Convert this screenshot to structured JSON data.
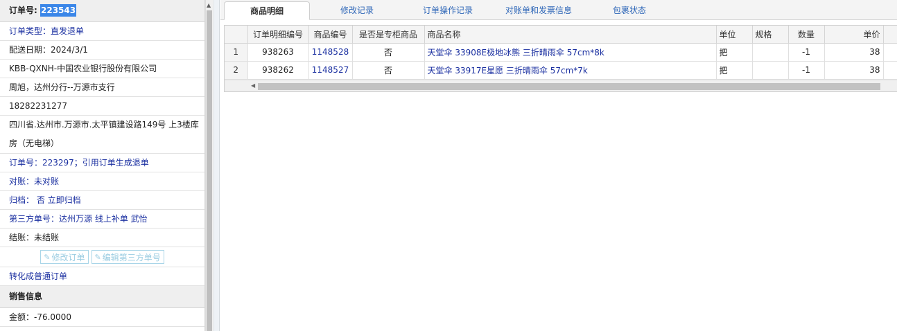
{
  "order": {
    "label": "订单号:",
    "number": "223543",
    "type": "订单类型：直发退单",
    "date": "配送日期：2024/3/1",
    "customer": "KBB-QXNH-中国农业银行股份有限公司",
    "contact": "周旭，达州分行--万源市支行",
    "phone": "18282231277",
    "address": "四川省.达州市.万源市.太平镇建设路149号 上3楼库房（无电梯）",
    "ref": "订单号：223297；引用订单生成退单",
    "reconcile": "对账：未对账",
    "archive": "归档： 否 立即归档",
    "third_party": "第三方单号：达州万源 线上补单 武怡",
    "settle": "结账：未结账",
    "edit_order_btn": "修改订单",
    "edit_third_btn": "编辑第三方单号",
    "convert": "转化成普通订单"
  },
  "sales": {
    "header": "销售信息",
    "amount": "金额：-76.0000"
  },
  "tabs": [
    {
      "label": "商品明细",
      "active": true
    },
    {
      "label": "修改记录",
      "active": false
    },
    {
      "label": "订单操作记录",
      "active": false
    },
    {
      "label": "对账单和发票信息",
      "active": false
    },
    {
      "label": "包裹状态",
      "active": false
    }
  ],
  "table": {
    "columns": [
      "",
      "订单明细编号",
      "商品编号",
      "是否是专柜商品",
      "商品名称",
      "单位",
      "规格",
      "数量",
      "单价"
    ],
    "rows": [
      {
        "n": "1",
        "detail_id": "938263",
        "sku": "1148528",
        "counter": "否",
        "name": "天堂伞 33908E极地冰熊 三折晴雨伞 57cm*8k",
        "unit": "把",
        "spec": "",
        "qty": "-1",
        "price": "38"
      },
      {
        "n": "2",
        "detail_id": "938262",
        "sku": "1148527",
        "counter": "否",
        "name": "天堂伞 33917E星愿 三折晴雨伞 57cm*7k",
        "unit": "把",
        "spec": "",
        "qty": "-1",
        "price": "38"
      }
    ]
  }
}
